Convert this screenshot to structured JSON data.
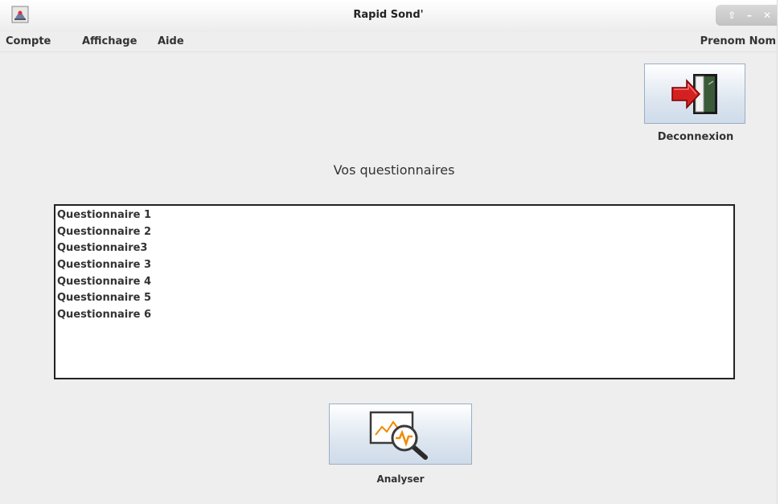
{
  "window": {
    "title": "Rapid Sond'",
    "controls": {
      "maximize": "⇧",
      "minimize": "–",
      "close": "✕"
    }
  },
  "menu": {
    "items": [
      {
        "label": "Compte"
      },
      {
        "label": "Affichage"
      },
      {
        "label": "Aide"
      }
    ],
    "user": "Prenom Nom"
  },
  "logout": {
    "label": "Deconnexion",
    "icon": "logout-door-icon"
  },
  "heading": "Vos questionnaires",
  "questionnaires": [
    "Questionnaire 1",
    "Questionnaire 2",
    "Questionnaire3",
    "Questionnaire 3",
    "Questionnaire 4",
    "Questionnaire 5",
    "Questionnaire 6"
  ],
  "analyze": {
    "label": "Analyser",
    "icon": "chart-magnifier-icon"
  },
  "colors": {
    "accent_orange": "#f08a00",
    "door_red": "#d42020",
    "button_border": "#9aaec6"
  }
}
